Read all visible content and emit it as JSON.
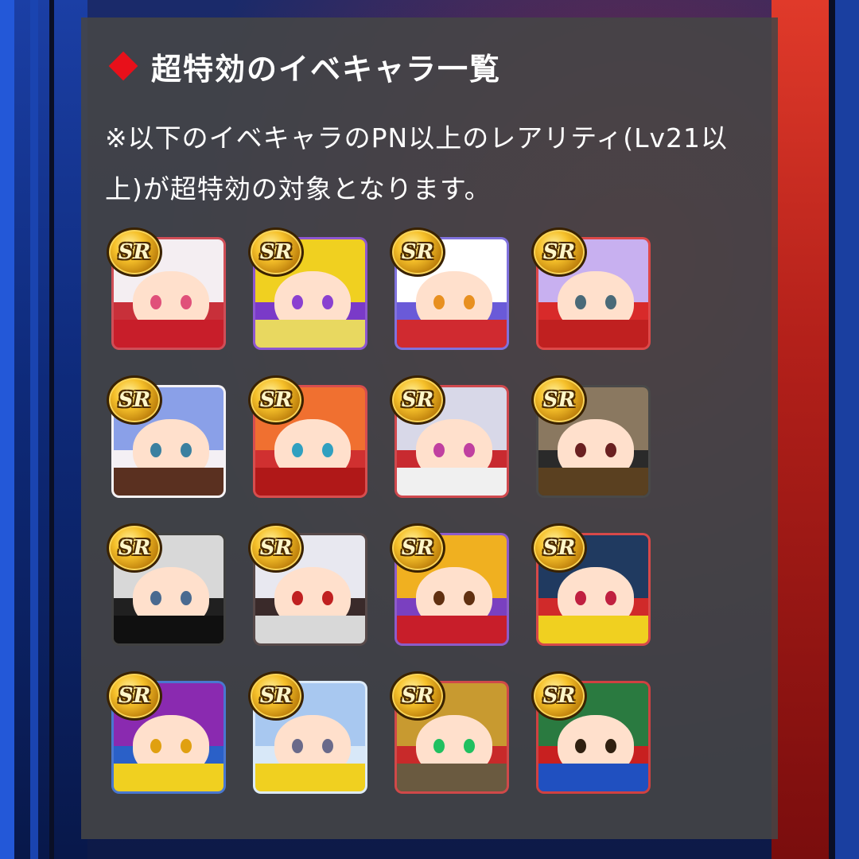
{
  "header": {
    "title": "超特効のイベキャラ一覧"
  },
  "note": {
    "text": "※以下のイベキャラのPN以上のレアリティ(Lv21以上)が超特効の対象となります。"
  },
  "badge_label": "SR",
  "characters": [
    {
      "rarity": "SR",
      "hair": "#f4eef2",
      "bg": "#c8303a",
      "eye": "#e0507a",
      "body": "#c81e2a"
    },
    {
      "rarity": "SR",
      "hair": "#f0d020",
      "bg": "#7a3ac8",
      "eye": "#8a40d0",
      "body": "#e8d860"
    },
    {
      "rarity": "SR",
      "hair": "#ffffff",
      "bg": "#6a5ad8",
      "eye": "#e89020",
      "body": "#d02a30"
    },
    {
      "rarity": "SR",
      "hair": "#c8b0f0",
      "bg": "#d82a2a",
      "eye": "#4a6a78",
      "body": "#c02020"
    },
    {
      "rarity": "SR",
      "hair": "#8aa0e8",
      "bg": "#f4f0f4",
      "eye": "#3a80a0",
      "body": "#5a3020"
    },
    {
      "rarity": "SR",
      "hair": "#f07030",
      "bg": "#d03030",
      "eye": "#30a0c0",
      "body": "#b01818"
    },
    {
      "rarity": "SR",
      "hair": "#d8d8e8",
      "bg": "#c82a30",
      "eye": "#c040a0",
      "body": "#f0f0f0"
    },
    {
      "rarity": "SR",
      "hair": "#8a7860",
      "bg": "#2a2a2a",
      "eye": "#6a2020",
      "body": "#5a4020"
    },
    {
      "rarity": "SR",
      "hair": "#d8d8d8",
      "bg": "#202020",
      "eye": "#4a6a90",
      "body": "#101010"
    },
    {
      "rarity": "SR",
      "hair": "#e8e8f0",
      "bg": "#3a2a2a",
      "eye": "#c02020",
      "body": "#d8d8d8"
    },
    {
      "rarity": "SR",
      "hair": "#f0b020",
      "bg": "#7a40c0",
      "eye": "#603010",
      "body": "#c81e2a"
    },
    {
      "rarity": "SR",
      "hair": "#203a60",
      "bg": "#d02a2a",
      "eye": "#c02040",
      "body": "#f0d020"
    },
    {
      "rarity": "SR",
      "hair": "#8a2ab0",
      "bg": "#2a60c8",
      "eye": "#e0a010",
      "body": "#f0d020"
    },
    {
      "rarity": "SR",
      "hair": "#a8c8f0",
      "bg": "#d8e8f8",
      "eye": "#6a6a8a",
      "body": "#f0d020"
    },
    {
      "rarity": "SR",
      "hair": "#c89a30",
      "bg": "#c82a2a",
      "eye": "#20c060",
      "body": "#6a5a40"
    },
    {
      "rarity": "SR",
      "hair": "#2a7a40",
      "bg": "#c82020",
      "eye": "#302010",
      "body": "#2050c0"
    }
  ]
}
